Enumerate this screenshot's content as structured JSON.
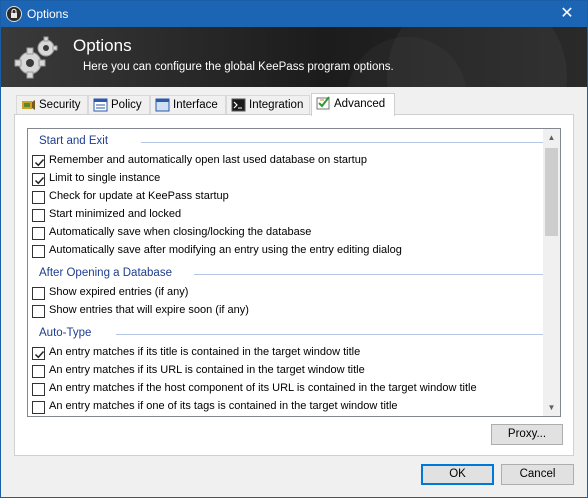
{
  "window": {
    "title": "Options",
    "close_glyph": "✕"
  },
  "banner": {
    "title": "Options",
    "subtitle": "Here you can configure the global KeePass program options."
  },
  "tabs": [
    {
      "label": "Security",
      "icon": "security-icon",
      "active": false
    },
    {
      "label": "Policy",
      "icon": "policy-icon",
      "active": false
    },
    {
      "label": "Interface",
      "icon": "interface-icon",
      "active": false
    },
    {
      "label": "Integration",
      "icon": "integration-icon",
      "active": false
    },
    {
      "label": "Advanced",
      "icon": "advanced-icon",
      "active": true
    }
  ],
  "groups": [
    {
      "title": "Start and Exit",
      "items": [
        {
          "label": "Remember and automatically open last used database on startup",
          "checked": true
        },
        {
          "label": "Limit to single instance",
          "checked": true
        },
        {
          "label": "Check for update at KeePass startup",
          "checked": false
        },
        {
          "label": "Start minimized and locked",
          "checked": false
        },
        {
          "label": "Automatically save when closing/locking the database",
          "checked": false
        },
        {
          "label": "Automatically save after modifying an entry using the entry editing dialog",
          "checked": false
        }
      ]
    },
    {
      "title": "After Opening a Database",
      "items": [
        {
          "label": "Show expired entries (if any)",
          "checked": false
        },
        {
          "label": "Show entries that will expire soon (if any)",
          "checked": false
        }
      ]
    },
    {
      "title": "Auto-Type",
      "items": [
        {
          "label": "An entry matches if its title is contained in the target window title",
          "checked": true
        },
        {
          "label": "An entry matches if its URL is contained in the target window title",
          "checked": false
        },
        {
          "label": "An entry matches if the host component of its URL is contained in the target window title",
          "checked": false
        },
        {
          "label": "An entry matches if one of its tags is contained in the target window title",
          "checked": false
        }
      ]
    }
  ],
  "buttons": {
    "proxy": "Proxy...",
    "ok": "OK",
    "cancel": "Cancel"
  },
  "scrollbar": {
    "up_glyph": "▲",
    "down_glyph": "▼"
  },
  "colors": {
    "titlebar": "#1c64b4",
    "group_header": "#1e3d8f",
    "accent": "#0078d7"
  }
}
